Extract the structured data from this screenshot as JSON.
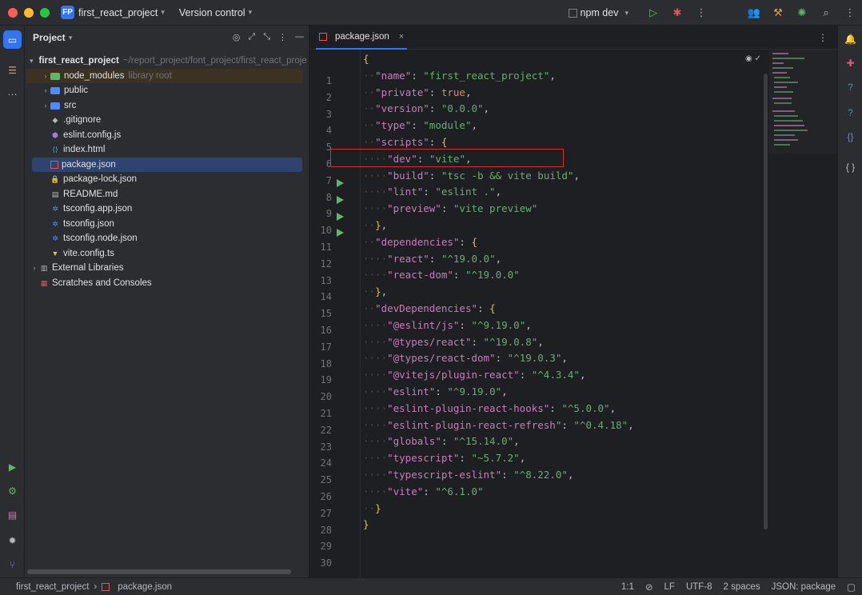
{
  "titlebar": {
    "project_badge": "FP",
    "project_name": "first_react_project",
    "vcs_label": "Version control",
    "run_config": "npm dev"
  },
  "project_panel": {
    "title": "Project",
    "root_name": "first_react_project",
    "root_path": "~/report_project/font_project/first_react_proje",
    "items": [
      {
        "label": "node_modules",
        "hint": "library root"
      },
      {
        "label": "public"
      },
      {
        "label": "src"
      },
      {
        "label": ".gitignore"
      },
      {
        "label": "eslint.config.js"
      },
      {
        "label": "index.html"
      },
      {
        "label": "package.json"
      },
      {
        "label": "package-lock.json"
      },
      {
        "label": "README.md"
      },
      {
        "label": "tsconfig.app.json"
      },
      {
        "label": "tsconfig.json"
      },
      {
        "label": "tsconfig.node.json"
      },
      {
        "label": "vite.config.ts"
      },
      {
        "label": "External Libraries"
      },
      {
        "label": "Scratches and Consoles"
      }
    ]
  },
  "editor": {
    "tab_label": "package.json",
    "line_numbers": [
      "1",
      "2",
      "3",
      "4",
      "5",
      "6",
      "7",
      "8",
      "9",
      "10",
      "11",
      "12",
      "13",
      "14",
      "15",
      "16",
      "17",
      "18",
      "19",
      "20",
      "21",
      "22",
      "23",
      "24",
      "25",
      "26",
      "27",
      "28",
      "29",
      "30"
    ],
    "code": {
      "l1_open": "{",
      "l2_key": "\"name\"",
      "l2_val": "\"first_react_project\"",
      "l3_key": "\"private\"",
      "l3_val": "true",
      "l4_key": "\"version\"",
      "l4_val": "\"0.0.0\"",
      "l5_key": "\"type\"",
      "l5_val": "\"module\"",
      "l6_key": "\"scripts\"",
      "l7_key": "\"dev\"",
      "l7_val": "\"vite\"",
      "l8_key": "\"build\"",
      "l8_val": "\"tsc -b && vite build\"",
      "l9_key": "\"lint\"",
      "l9_val": "\"eslint .\"",
      "l10_key": "\"preview\"",
      "l10_val": "\"vite preview\"",
      "l12_key": "\"dependencies\"",
      "l13_key": "\"react\"",
      "l13_val": "\"^19.0.0\"",
      "l14_key": "\"react-dom\"",
      "l14_val": "\"^19.0.0\"",
      "l16_key": "\"devDependencies\"",
      "l17_key": "\"@eslint/js\"",
      "l17_val": "\"^9.19.0\"",
      "l18_key": "\"@types/react\"",
      "l18_val": "\"^19.0.8\"",
      "l19_key": "\"@types/react-dom\"",
      "l19_val": "\"^19.0.3\"",
      "l20_key": "\"@vitejs/plugin-react\"",
      "l20_val": "\"^4.3.4\"",
      "l21_key": "\"eslint\"",
      "l21_val": "\"^9.19.0\"",
      "l22_key": "\"eslint-plugin-react-hooks\"",
      "l22_val": "\"^5.0.0\"",
      "l23_key": "\"eslint-plugin-react-refresh\"",
      "l23_val": "\"^0.4.18\"",
      "l24_key": "\"globals\"",
      "l24_val": "\"^15.14.0\"",
      "l25_key": "\"typescript\"",
      "l25_val": "\"~5.7.2\"",
      "l26_key": "\"typescript-eslint\"",
      "l26_val": "\"^8.22.0\"",
      "l27_key": "\"vite\"",
      "l27_val": "\"^6.1.0\"",
      "l29_close": "}"
    }
  },
  "statusbar": {
    "crumb_project": "first_react_project",
    "crumb_file": "package.json",
    "position": "1:1",
    "line_sep": "LF",
    "encoding": "UTF-8",
    "indent": "2 spaces",
    "filetype": "JSON: package"
  },
  "colors": {
    "accent": "#3574f0",
    "highlight_box": "#d0312d"
  }
}
